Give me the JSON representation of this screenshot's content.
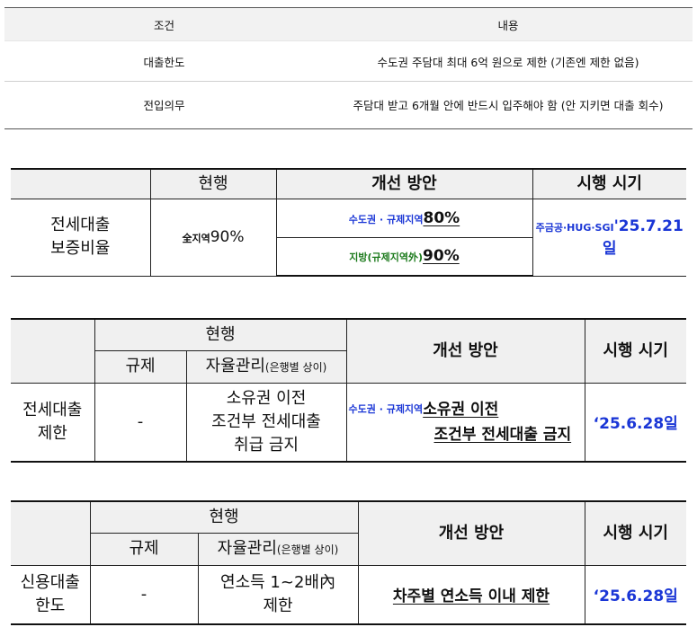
{
  "table1": {
    "headers": [
      "조건",
      "내용"
    ],
    "rows": [
      [
        "대출한도",
        "수도권 주담대 최대 6억 원으로 제한 (기존엔 제한 없음)"
      ],
      [
        "전입의무",
        "주담대 받고 6개월 안에 반드시 입주해야 함 (안 지키면 대출 회수)"
      ]
    ]
  },
  "table2": {
    "headers": [
      "현행",
      "개선 방안",
      "시행 시기"
    ],
    "row_label": "전세대출\n보증비율",
    "current_prefix": "全지역",
    "current_value": "90%",
    "improve1_prefix": "수도권 · 규제지역",
    "improve1_value": "80%",
    "improve2_prefix": "지방(규제지역外)",
    "improve2_value": "90%",
    "date_prefix": "주금공·HUG·SGI",
    "date_value": "'25.7.21일"
  },
  "table3": {
    "header_current": "현행",
    "header_reg": "규제",
    "header_self": "자율관리",
    "header_self_sub": "(은행별 상이)",
    "header_improve": "개선 방안",
    "header_date": "시행 시기",
    "row_label": "전세대출\n제한",
    "reg_value": "-",
    "self_value": "소유권 이전\n조건부 전세대출\n취급 금지",
    "improve_prefix": "수도권 · 규제지역",
    "improve_line1": "소유권 이전",
    "improve_line2": "조건부 전세대출 금지",
    "date_value": "‘25.6.28일"
  },
  "table4": {
    "header_current": "현행",
    "header_reg": "규제",
    "header_self": "자율관리",
    "header_self_sub": "(은행별 상이)",
    "header_improve": "개선 방안",
    "header_date": "시행 시기",
    "row_label": "신용대출\n한도",
    "reg_value": "-",
    "self_value": "연소득 1~2배內\n제한",
    "improve_value": "차주별 연소득 이내 제한",
    "date_value": "‘25.6.28일"
  }
}
